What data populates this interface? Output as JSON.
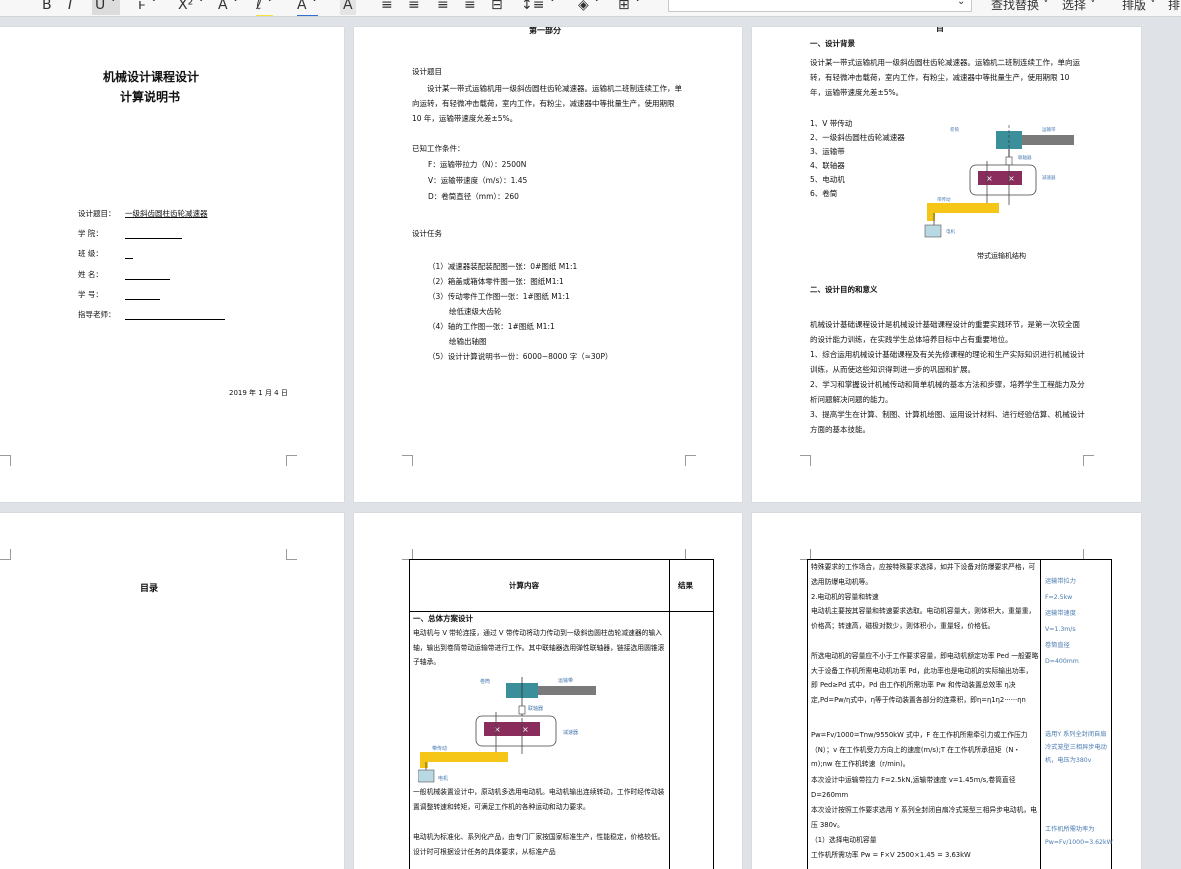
{
  "toolbar": {
    "find_replace": "查找替换",
    "select": "选择",
    "arrange": "排版",
    "arrange2": "排"
  },
  "page1": {
    "title1": "机械设计课程设计",
    "title2": "计算说明书",
    "fields": [
      {
        "label": "设计题目：",
        "value": "一级斜齿圆柱齿轮减速器"
      },
      {
        "label": "学    院：",
        "value": ""
      },
      {
        "label": "班    级：",
        "value": ""
      },
      {
        "label": "姓    名：",
        "value": ""
      },
      {
        "label": "学    号：",
        "value": ""
      },
      {
        "label": "指导老师：",
        "value": ""
      }
    ],
    "date": "2019 年 1 月 4 日"
  },
  "page2": {
    "header": "第一部分",
    "topic_heading": "设计题目",
    "topic_text": "设计某一带式运输机用一级斜齿圆柱齿轮减速器。运输机二班制连续工作，单向运转，有轻微冲击载荷，室内工作，有粉尘，减速器中等批量生产，使用期限 10 年，运输带速度允差±5%。",
    "known_heading": "已知工作条件：",
    "conditions": [
      "F：运输带拉力（N）：2500N",
      "V：运输带速度（m/s）：1.45",
      "D：卷筒直径（mm）：260"
    ],
    "tasks_heading": "设计任务",
    "tasks": [
      "（1）减速器装配装配图一张：0#图纸 M1:1",
      "（2）箱盖或箱体零件图一张：图纸M1:1",
      "（3）传动零件工作图一张：1#图纸 M1:1",
      "绘低速级大齿轮",
      "（4）轴的工作图一张：1#图纸 M1:1",
      "绘输出轴图",
      "（5）设计计算说明书一份：6000~8000 字（≈30P）"
    ]
  },
  "page3": {
    "header": "目 ",
    "s1_heading": "一、设计背景",
    "s1_text": "设计某一带式运输机用一级斜齿圆柱齿轮减速器。运输机二班制连续工作，单向运转，有轻微冲击载荷，室内工作，有粉尘，减速器中等批量生产，使用期限 10 年，运输带速度允差±5%。",
    "parts": [
      "1、V 带传动",
      "2、一级斜齿圆柱齿轮减速器",
      "3、运输带",
      "4、联轴器",
      "5、电动机",
      "6、卷筒"
    ],
    "figure_caption": "带式运输机结构",
    "fig_labels": {
      "drum": "卷筒",
      "belt": "运输带",
      "coupling": "联轴器",
      "reducer": "减速器",
      "vbelt": "带传动",
      "motor": "电机"
    },
    "s2_heading": "二、设计目的和意义",
    "s2_paragraphs": [
      "机械设计基础课程设计是机械设计基础课程设计的重要实践环节，是第一次较全面的设计能力训练，在实践学生总体培养目标中占有重要地位。",
      "1、综合运用机械设计基础课程及有关先修课程的理论和生产实际知识进行机械设计训练，从而使这些知识得到进一步的巩固和扩展。",
      "2、学习和掌握设计机械传动和简单机械的基本方法和步骤，培养学生工程能力及分析问题解决问题的能力。",
      "3、提高学生在计算、制图、计算机绘图、运用设计材料、进行经验估算、机械设计方面的基本技能。"
    ]
  },
  "page4": {
    "toc": "目录"
  },
  "page5": {
    "col1": "计算内容",
    "col2": "结果",
    "s_heading": "一、总体方案设计",
    "intro": "电动机与 V 带轮连接，通过 V 带传动将动力传动到一级斜齿圆柱齿轮减速器的输入轴，输出到卷筒带动运输带进行工作。其中联轴器选用弹性联轴器，链接选用圆锥滚子轴承。",
    "fig_labels": {
      "drum": "卷筒",
      "belt": "运输带",
      "coupling": "联轴器",
      "reducer": "减速器",
      "vbelt": "带传动",
      "motor": "电机"
    },
    "text2": "一般机械装置设计中，原动机多选用电动机。电动机输出连续转动，工作时经传动装置调整转速和转矩，可满足工作机的各种运动和动力要求。",
    "text3": "电动机为标准化、系列化产品，由专门厂家按国家标准生产，性能稳定，价格较低。设计时可根据设计任务的具体要求，从标准产品"
  },
  "page6": {
    "lines": [
      "特殊要求的工作场合，应按特殊要求选择，如井下设备对防爆要求严格，可选用防爆电动机等。",
      "2.电动机的容量和转速",
      "电动机主要按其容量和转速要求选取。电动机容量大，则体积大，重量重，价格高；转速高，磁极对数少，则体积小，重量轻，价格低。",
      "所选电动机的容量应不小于工作要求容量，即电动机额定功率 Ped 一般要略大于设备工作机所需电动机功率 Pd，此功率也是电动机的实际输出功率，即 Ped≥Pd 式中，Pd 由工作机所需功率 Pw 和传动装置总效率 η决定,Pd=Pw/η式中，η等于传动装置各部分的连乘积，即η=η1η2······ηn",
      "Pw=Fv/1000=Tnw/9550kW 式中，F 在工作机所需牵引力或工作压力（N）；v 在工作机受力方向上的速度(m/s);T 在工作机所承扭矩（N・m);nw 在工作机转速（r/min)。",
      "本次设计中运输带拉力 F=2.5kN,运输带速度 v=1.45m/s,卷筒直径 D=260mm",
      "本次设计按照工作要求选用 Y 系列全封闭自扇冷式笼型三相异步电动机，电压 380v。",
      "（1）选择电动机容量",
      "工作机所需功率 Pw =   F×V      2500×1.45   = 3.63kW"
    ],
    "side": [
      "运输带拉力",
      "F=2.5kw",
      "运输带速度",
      "V=1.3m/s",
      "卷筒直径",
      "D=400mm",
      "选用Y 系列全封闭自扇冷式笼型三相异步电动机，电压为380v",
      "工作机所需功率为 Pw=Fv/1000=3.62kW"
    ]
  }
}
